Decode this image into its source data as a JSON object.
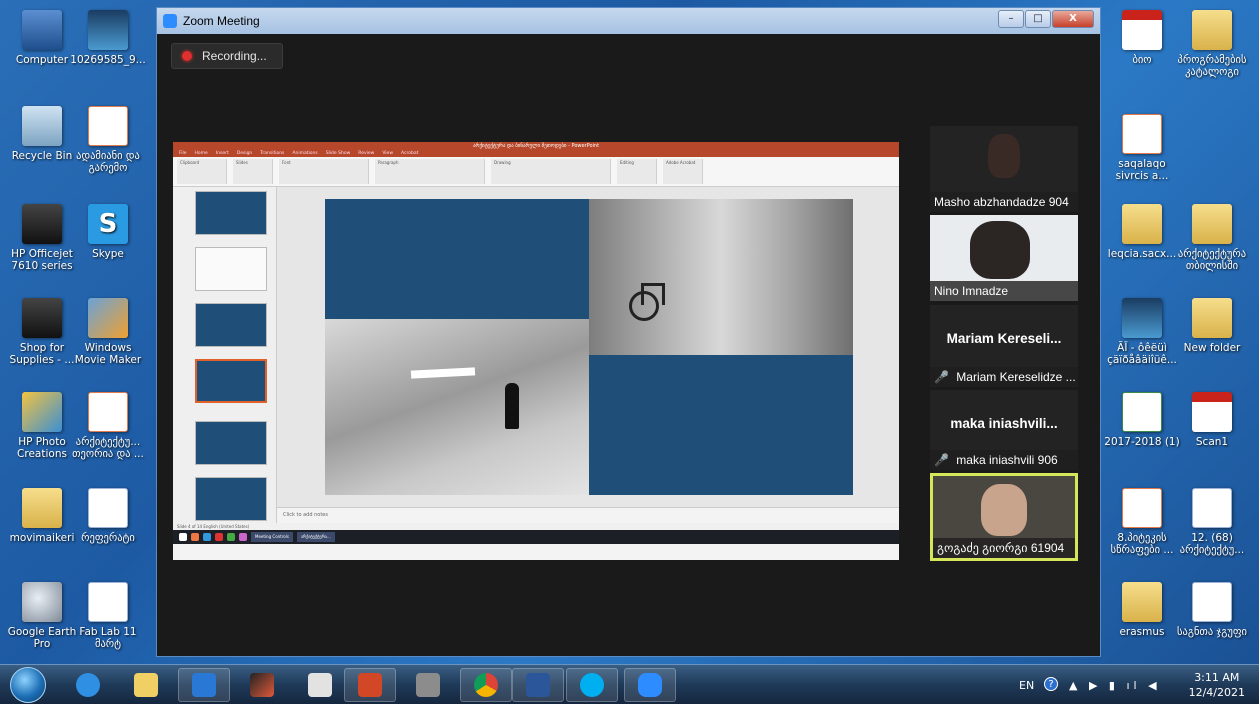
{
  "desktop": {
    "icons_left": [
      {
        "label": "Computer",
        "kind": "pc"
      },
      {
        "label": "10269585_9...",
        "kind": "img"
      },
      {
        "label": "Recycle Bin",
        "kind": "bin"
      },
      {
        "label": "ადამიანი და გარემო",
        "kind": "ppt"
      },
      {
        "label": "HP Officejet 7610 series",
        "kind": "printer"
      },
      {
        "label": "Skype",
        "kind": "skype"
      },
      {
        "label": "Shop for Supplies - ...",
        "kind": "printer"
      },
      {
        "label": "Windows Movie Maker",
        "kind": "movie"
      },
      {
        "label": "HP Photo Creations",
        "kind": "photo"
      },
      {
        "label": "არქიტექტუ... თეორია და ...",
        "kind": "ppt"
      },
      {
        "label": "movimaikeri",
        "kind": "folder"
      },
      {
        "label": "რეფერატი",
        "kind": "doc"
      },
      {
        "label": "Google Earth Pro",
        "kind": "globe"
      },
      {
        "label": "Fab Lab 11 მარტ",
        "kind": "doc"
      }
    ],
    "icons_right": [
      {
        "label": "ბიო",
        "kind": "pdf"
      },
      {
        "label": "პროგრამების კატალოგი",
        "kind": "folder"
      },
      {
        "label": "saqalaqo sivrcis a...",
        "kind": "ppt"
      },
      {
        "label": "leqcia.sacx...",
        "kind": "folder"
      },
      {
        "label": "არქიტექტურა თბილისში",
        "kind": "folder"
      },
      {
        "label": "ÃĪ - ôêëüì çäïðåâäiîüê...",
        "kind": "img"
      },
      {
        "label": "New folder",
        "kind": "folder"
      },
      {
        "label": "2017-2018 (1)",
        "kind": "xls"
      },
      {
        "label": "Scan1",
        "kind": "pdf"
      },
      {
        "label": "8.პიტეკის სწრაფები ...",
        "kind": "ppt"
      },
      {
        "label": "12. (68) არქიტექტუ...",
        "kind": "doc"
      },
      {
        "label": "erasmus",
        "kind": "folder"
      },
      {
        "label": "საგნთა ჯგუფი",
        "kind": "doc"
      }
    ]
  },
  "zoom": {
    "title": "Zoom Meeting",
    "recording_label": "Recording...",
    "window_buttons": {
      "minimize": "–",
      "maximize": "□",
      "close": "X"
    },
    "shared_screen": {
      "ppt_title": "არქიტექტურა და ბინარული მეთოდები - PowerPoint",
      "ribbon_tabs": [
        "File",
        "Home",
        "Insert",
        "Design",
        "Transitions",
        "Animations",
        "Slide Show",
        "Review",
        "View",
        "Acrobat"
      ],
      "ribbon_groups": [
        "Clipboard",
        "Slides",
        "Font",
        "Paragraph",
        "Drawing",
        "Editing",
        "Adobe Acrobat"
      ],
      "notes_placeholder": "Click to add notes",
      "status": "Slide 4 of 14   English (United States)",
      "taskbar_tasks": [
        "Meeting Controls",
        "არქიტექტურა..."
      ],
      "thumb_count": 6,
      "selected_thumb": 4
    },
    "participants": [
      {
        "name": "Masho abzhandadze 904",
        "has_video": true,
        "muted": false
      },
      {
        "name": "Nino Imnadze",
        "has_video": true,
        "muted": false
      },
      {
        "name": "Mariam Kereselidze ...",
        "display": "Mariam  Kereseli...",
        "has_video": false,
        "muted": true
      },
      {
        "name": "maka iniashvili 906",
        "display": "maka  iniashvili...",
        "has_video": false,
        "muted": true
      },
      {
        "name": "გოგაძე გიორგი 61904",
        "has_video": true,
        "muted": false,
        "active": true
      }
    ]
  },
  "taskbar": {
    "apps": [
      "internet-explorer",
      "explorer",
      "media-player",
      "archicad",
      "snipping-tool",
      "powerpoint",
      "cash-register",
      "chrome",
      "word",
      "skype",
      "zoom"
    ],
    "tray": {
      "language": "EN",
      "time": "3:11 AM",
      "date": "12/4/2021"
    }
  },
  "colors": {
    "slide_blue": "#1f4e79",
    "ppt_red": "#b7472a",
    "zoom_dark": "#1a1a1a",
    "active_speaker": "#d6e65a",
    "muted_red": "#e02f2f"
  }
}
